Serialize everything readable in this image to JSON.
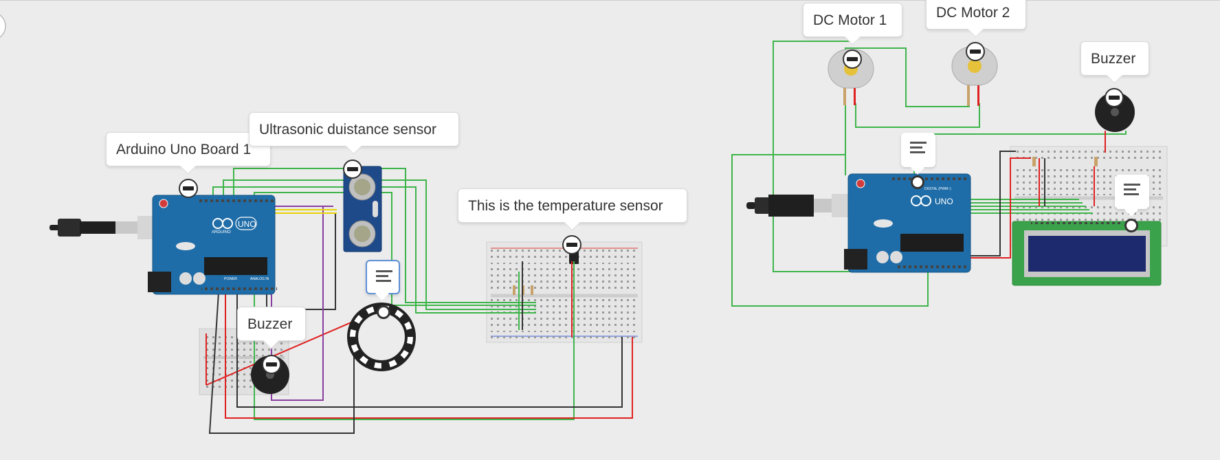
{
  "labels": {
    "arduino1": "Arduino Uno Board 1",
    "ultrasonic": "Ultrasonic duistance sensor",
    "temperature": "This is the temperature sensor",
    "buzzer_left": "Buzzer",
    "motor1": "DC Motor 1",
    "motor2": "DC Motor 2",
    "buzzer_right": "Buzzer"
  },
  "board_text": {
    "uno": "UNO",
    "arduino": "ARDUINO",
    "digital": "DIGITAL (PWM~)",
    "power": "POWER",
    "analog": "ANALOG IN"
  },
  "colors": {
    "canvas": "#ececec",
    "board": "#1f6da8",
    "wire_green": "#3db54a",
    "wire_red": "#e02020",
    "wire_black": "#333333",
    "wire_purple": "#8a3fa0",
    "wire_yellow": "#e8d400",
    "lcd_pcb": "#3aa24a",
    "lcd_screen": "#1d2a6e",
    "breadboard": "#e4e4e4"
  },
  "icons": [
    "note-icon",
    "annotation-pin-icon",
    "usb-plug-icon",
    "arduino-logo-icon"
  ]
}
